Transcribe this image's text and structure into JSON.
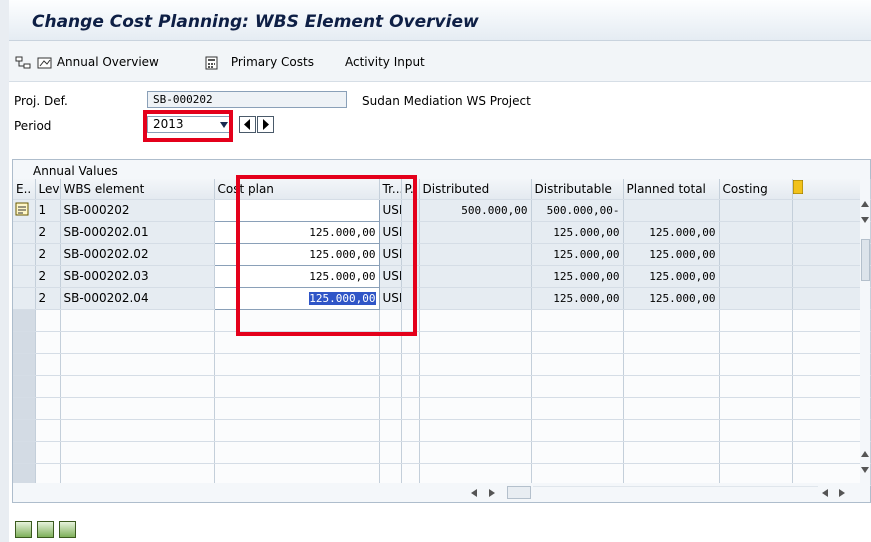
{
  "window": {
    "title": "Change Cost Planning: WBS Element Overview"
  },
  "toolbar": {
    "annual_overview": "Annual Overview",
    "primary_costs": "Primary Costs",
    "activity_input": "Activity Input"
  },
  "header": {
    "proj_def_label": "Proj. Def.",
    "proj_def_value": "SB-000202",
    "proj_def_desc": "Sudan Mediation WS Project",
    "period_label": "Period",
    "period_value": "2013"
  },
  "section": {
    "title": "Annual Values"
  },
  "table": {
    "columns": [
      "E..",
      "Lev",
      "WBS element",
      "Cost plan",
      "Tr...",
      "P..",
      "Distributed",
      "Distributable",
      "Planned total",
      "Costing"
    ],
    "rows": [
      {
        "lev": "1",
        "wbs": "SB-000202",
        "cost_plan": "",
        "currency": "USD",
        "distributed": "500.000,00",
        "distributable": "500.000,00-",
        "planned_total": ""
      },
      {
        "lev": "2",
        "wbs": "SB-000202.01",
        "cost_plan": "125.000,00",
        "currency": "USD",
        "distributed": "",
        "distributable": "125.000,00",
        "planned_total": "125.000,00"
      },
      {
        "lev": "2",
        "wbs": "SB-000202.02",
        "cost_plan": "125.000,00",
        "currency": "USD",
        "distributed": "",
        "distributable": "125.000,00",
        "planned_total": "125.000,00"
      },
      {
        "lev": "2",
        "wbs": "SB-000202.03",
        "cost_plan": "125.000,00",
        "currency": "USD",
        "distributed": "",
        "distributable": "125.000,00",
        "planned_total": "125.000,00"
      },
      {
        "lev": "2",
        "wbs": "SB-000202.04",
        "cost_plan": "125.000,00",
        "currency": "USD",
        "distributed": "",
        "distributable": "125.000,00",
        "planned_total": "125.000,00"
      }
    ]
  },
  "colors": {
    "highlight_red": "#e4001b",
    "selection_blue": "#2f55c7",
    "title_text": "#0e1f45"
  }
}
